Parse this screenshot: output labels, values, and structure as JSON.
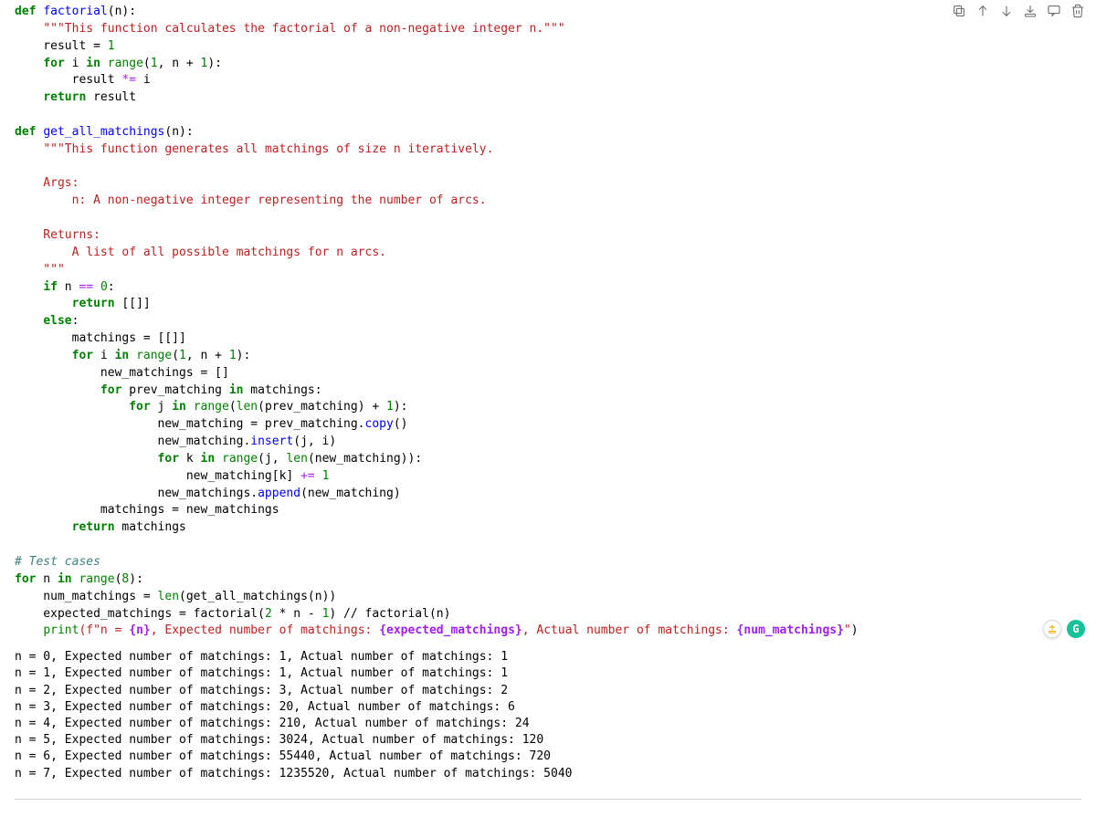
{
  "toolbar": {
    "icons": [
      "copy",
      "arrow-up",
      "arrow-down",
      "link",
      "comment",
      "trash"
    ]
  },
  "code": {
    "t": {
      "def": "def",
      "for": "for",
      "in": "in",
      "return": "return",
      "if": "if",
      "else": "else",
      "range": "range",
      "len": "len",
      "print": "print"
    },
    "fn_factorial": "factorial",
    "fn_get_all": "get_all_matchings",
    "meth_copy": "copy",
    "meth_insert": "insert",
    "meth_append": "append",
    "l1a": "(n):",
    "l2": "\"\"\"This function calculates the factorial of a non-negative integer n.\"\"\"",
    "l3a": "    result = ",
    "l3b": "1",
    "l4a": " i ",
    "l4b": "(",
    "l4c": "1",
    "l4d": ", n + ",
    "l4e": "1",
    "l4f": "):",
    "l5a": "        result ",
    "l5b": "*=",
    "l5c": " i",
    "l6a": " result",
    "l8": "(n):",
    "doc2a": "\"\"\"This function generates all matchings of size n iteratively.",
    "doc2b": "    Args:",
    "doc2c": "        n: A non-negative integer representing the number of arcs.",
    "doc2d": "    Returns:",
    "doc2e": "        A list of all possible matchings for n arcs.",
    "doc2f": "    \"\"\"",
    "l16a": " n ",
    "l16b": "==",
    "l16c": " ",
    "l16d": "0",
    "l16e": ":",
    "l17a": " [[]]",
    "l18a": ":",
    "l19": "        matchings = [[]]",
    "l20a": " i ",
    "l20b": "(",
    "l20c": "1",
    "l20d": ", n + ",
    "l20e": "1",
    "l20f": "):",
    "l21": "            new_matchings = []",
    "l22a": " prev_matching ",
    "l22b": " matchings:",
    "l23a": " j ",
    "l23b": "(",
    "l23c": "(prev_matching) + ",
    "l23d": "1",
    "l23e": "):",
    "l24a": "                    new_matching = prev_matching.",
    "l24b": "()",
    "l25a": "                    new_matching.",
    "l25b": "(j, i)",
    "l26a": " k ",
    "l26b": "(j, ",
    "l26c": "(new_matching)):",
    "l27a": "                        new_matching[k] ",
    "l27b": "+=",
    "l27c": " ",
    "l27d": "1",
    "l28a": "                    new_matchings.",
    "l28b": "(new_matching)",
    "l29": "            matchings = new_matchings",
    "l30a": " matchings",
    "comment_tc": "# Test cases",
    "l33a": " n ",
    "l33b": "(",
    "l33c": "8",
    "l33d": "):",
    "l34a": "    num_matchings = ",
    "l34b": "(get_all_matchings(n))",
    "l35a": "    expected_matchings = factorial(",
    "l35b": "2",
    "l35c": " * n - ",
    "l35d": "1",
    "l35e": ") // factorial(n)",
    "l36a": "(f\"n = ",
    "l36b": "{n}",
    "l36c": ", Expected number of matchings: ",
    "l36d": "{expected_matchings}",
    "l36e": ", Actual number of matchings: ",
    "l36f": "{num_matchings}",
    "l36g": "\"",
    "l36h": ")"
  },
  "output": {
    "lines": [
      "n = 0, Expected number of matchings: 1, Actual number of matchings: 1",
      "n = 1, Expected number of matchings: 1, Actual number of matchings: 1",
      "n = 2, Expected number of matchings: 3, Actual number of matchings: 2",
      "n = 3, Expected number of matchings: 20, Actual number of matchings: 6",
      "n = 4, Expected number of matchings: 210, Actual number of matchings: 24",
      "n = 5, Expected number of matchings: 3024, Actual number of matchings: 120",
      "n = 6, Expected number of matchings: 55440, Actual number of matchings: 720",
      "n = 7, Expected number of matchings: 1235520, Actual number of matchings: 5040"
    ]
  },
  "badges": {
    "g": "G"
  }
}
